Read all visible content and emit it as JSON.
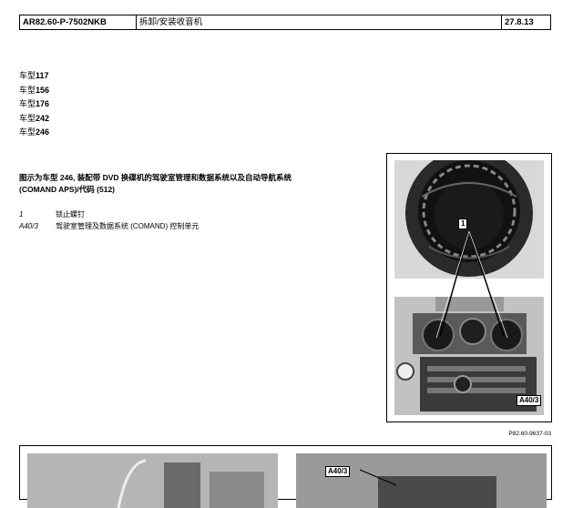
{
  "header": {
    "code": "AR82.60-P-7502NKB",
    "title": "拆卸/安装收音机",
    "date": "27.8.13"
  },
  "models": [
    {
      "prefix": "车型",
      "num": "117"
    },
    {
      "prefix": "车型",
      "num": "156"
    },
    {
      "prefix": "车型",
      "num": "176"
    },
    {
      "prefix": "车型",
      "num": "242"
    },
    {
      "prefix": "车型",
      "num": "246"
    }
  ],
  "description": {
    "line1": "图示为车型 246, 装配带 DVD 换碟机的驾驶室管理和数据系统以及自动导航系统",
    "line2": "(COMAND APS)/代码 (512)"
  },
  "legend": [
    {
      "key": "1",
      "text": "锁止螺钉"
    },
    {
      "key": "A40/3",
      "text": "驾驶室管理及数据系统 (COMAND) 控制单元"
    }
  ],
  "figure": {
    "callout_1": "1",
    "callout_a403": "A40/3",
    "ref": "P82.60-9637-03"
  },
  "bottom_figure": {
    "callout_a403": "A40/3"
  }
}
